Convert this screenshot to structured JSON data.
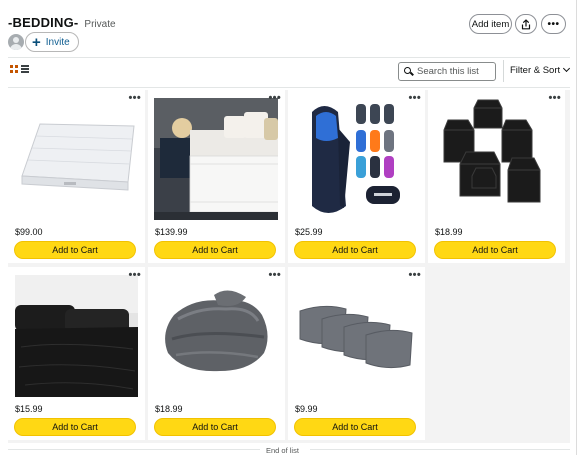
{
  "header": {
    "title": "-BEDDING-",
    "privacy": "Private",
    "invite_label": "Invite",
    "add_item_label": "Add item",
    "more_label": "•••"
  },
  "toolbar": {
    "search_placeholder": "Search this list",
    "filter_sort_label": "Filter & Sort"
  },
  "items": [
    {
      "price": "$99.00",
      "button": "Add to Cart",
      "more": "•••",
      "image": "mattress"
    },
    {
      "price": "$139.99",
      "button": "Add to Cart",
      "more": "•••",
      "image": "mattress-bedroom"
    },
    {
      "price": "$25.99",
      "button": "Add to Cart",
      "more": "•••",
      "image": "sleeping-bag"
    },
    {
      "price": "$18.99",
      "button": "Add to Cart",
      "more": "•••",
      "image": "bed-risers"
    },
    {
      "price": "$15.99",
      "button": "Add to Cart",
      "more": "•••",
      "image": "black-sheets"
    },
    {
      "price": "$18.99",
      "button": "Add to Cart",
      "more": "•••",
      "image": "gray-throw-blanket"
    },
    {
      "price": "$9.99",
      "button": "Add to Cart",
      "more": "•••",
      "image": "gray-pillowcases"
    }
  ],
  "footer": {
    "end_label": "End of list"
  },
  "colors": {
    "add_to_cart": "#ffd814",
    "active_view": "#c45500",
    "link": "#0f5e91"
  }
}
